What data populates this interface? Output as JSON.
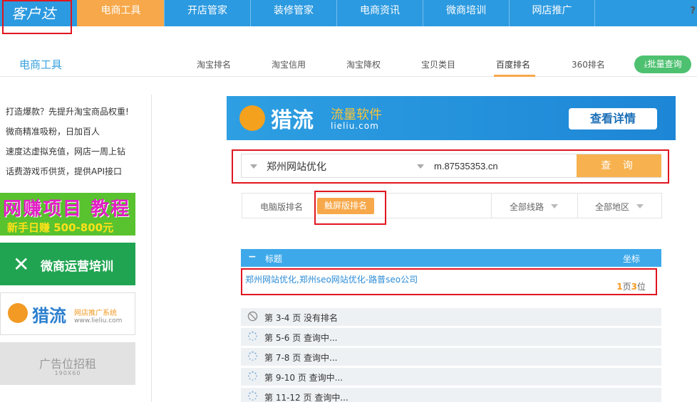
{
  "topnav": {
    "logo": "客户达",
    "items": [
      "电商工具",
      "开店管家",
      "装修管家",
      "电商资讯",
      "微商培训",
      "网店推广"
    ],
    "help": "?"
  },
  "subnav": {
    "title": "电商工具",
    "tabs": [
      "淘宝排名",
      "淘宝信用",
      "淘宝降权",
      "宝贝类目",
      "百度排名",
      "360排名"
    ],
    "batch_button": "批量查询"
  },
  "sidebar": {
    "promos": [
      "打造爆款？先提升淘宝商品权重!",
      "微商精准吸粉，日加百人",
      "速度达虚拟充值，网店一周上钻",
      "话费游戏币供货，提供API接口"
    ],
    "ad1": {
      "line1": "网赚项目 教程",
      "line2": "新手日赚 500-800元"
    },
    "ad2": {
      "text": "微商运营培训"
    },
    "ad3": {
      "brand": "猎流",
      "sub": "网店推广系统",
      "url": "www.lieliu.com"
    },
    "ad4": {
      "text": "广告位招租",
      "size": "190X60"
    }
  },
  "banner": {
    "brand": "猎流",
    "tagline": "流量软件",
    "url": "lieliu.com",
    "button": "查看详情"
  },
  "search": {
    "keyword": "郑州网站优化",
    "domain": "m.87535353.cn",
    "button": "查 询"
  },
  "filters": {
    "pc_tab": "电脑版排名",
    "mobile_tab": "触屏版排名",
    "line_select": "全部线路",
    "region_select": "全部地区"
  },
  "results": {
    "header_title": "标题",
    "header_pos": "坐标",
    "minus": "−",
    "row": {
      "title": "郑州网站优化,郑州seo网站优化-路普seo公司",
      "page_num": "1",
      "page_unit": "页",
      "pos_num": "3",
      "pos_unit": "位"
    },
    "status": [
      {
        "icon": "no-result-icon",
        "text": "第 3-4 页 没有排名"
      },
      {
        "icon": "loading-icon",
        "text": "第 5-6 页 查询中..."
      },
      {
        "icon": "loading-icon",
        "text": "第 7-8 页 查询中..."
      },
      {
        "icon": "loading-icon",
        "text": "第 9-10 页 查询中..."
      },
      {
        "icon": "loading-icon",
        "text": "第 11-12 页 查询中..."
      }
    ]
  },
  "colors": {
    "nav_blue": "#2c9ae0",
    "accent_orange": "#f7a84a",
    "highlight_red": "#e0151f",
    "green": "#4ec171"
  }
}
